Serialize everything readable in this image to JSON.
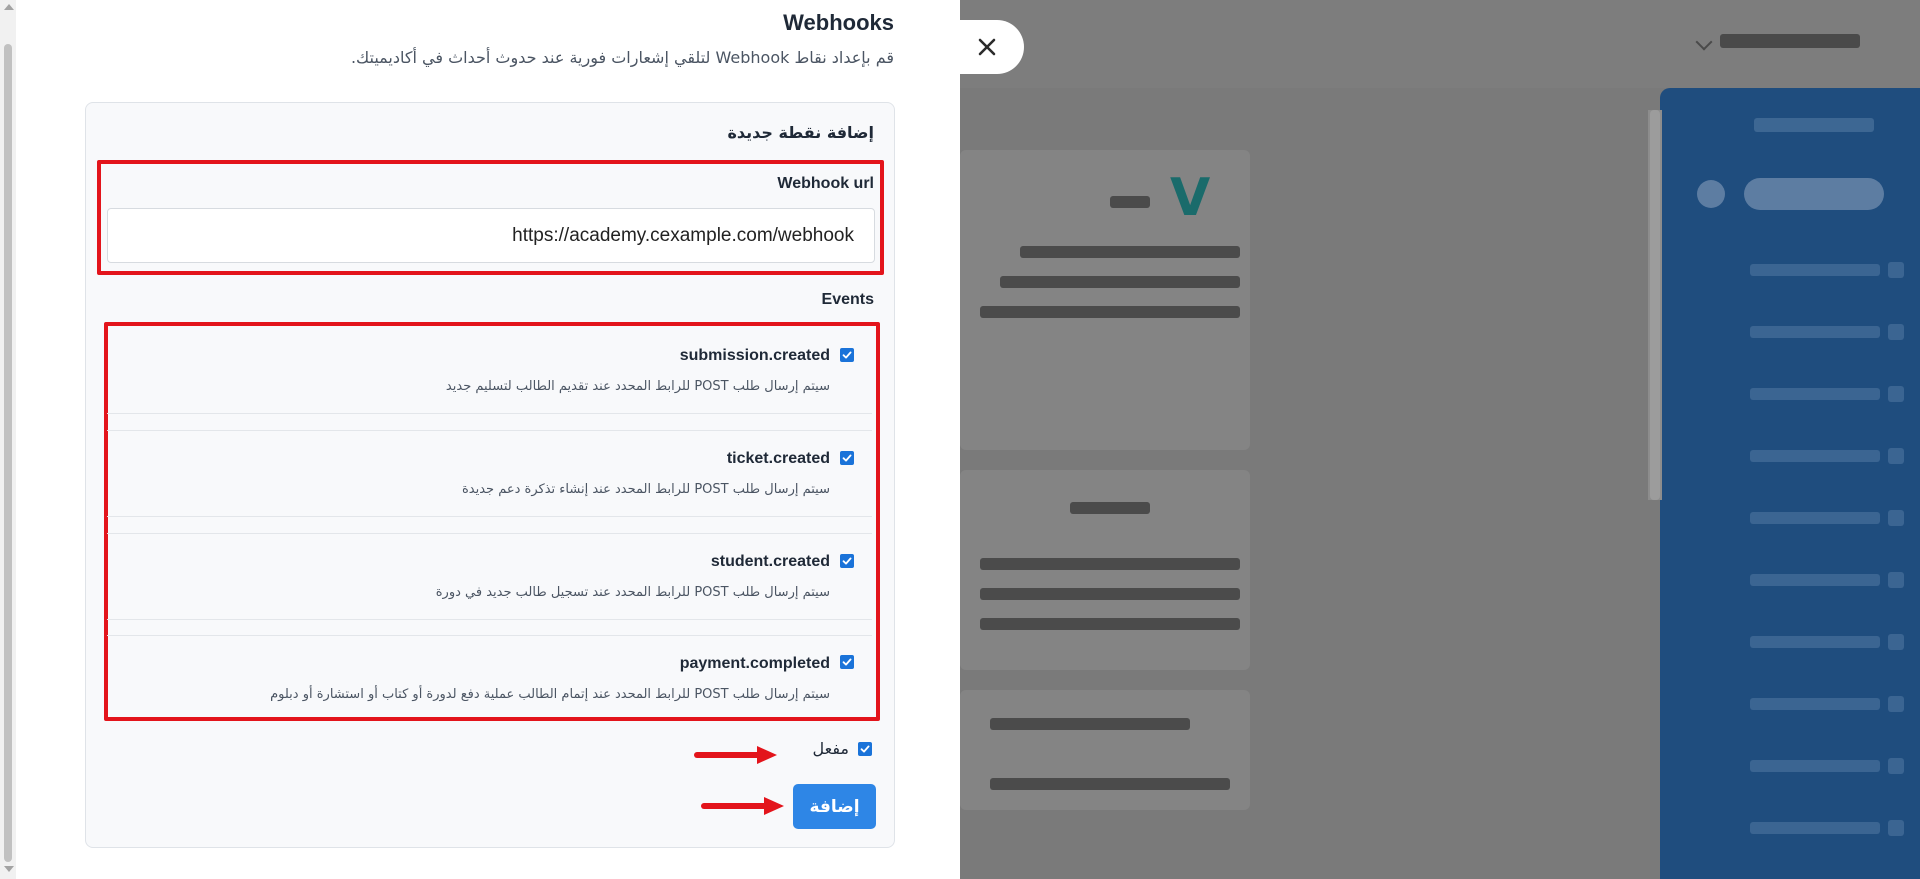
{
  "drawer": {
    "title": "Webhooks",
    "subtitle": "قم بإعداد نقاط Webhook لتلقي إشعارات فورية عند حدوث أحداث في أكاديميتك."
  },
  "form": {
    "heading": "إضافة نقطة جديدة",
    "url_label": "Webhook url",
    "url_value": "https://academy.cexample.com/webhook",
    "events_label": "Events",
    "events": [
      {
        "name": "submission.created",
        "description": "سيتم إرسال طلب POST للرابط المحدد عند تقديم الطالب لتسليم جديد",
        "checked": true
      },
      {
        "name": "ticket.created",
        "description": "سيتم إرسال طلب POST للرابط المحدد عند إنشاء تذكرة دعم جديدة",
        "checked": true
      },
      {
        "name": "student.created",
        "description": "سيتم إرسال طلب POST للرابط المحدد عند تسجيل طالب جديد في دورة",
        "checked": true
      },
      {
        "name": "payment.completed",
        "description": "سيتم إرسال طلب POST للرابط المحدد عند إتمام الطالب عملية دفع لدورة أو كتاب أو استشارة أو دبلوم",
        "checked": true
      }
    ],
    "enabled_label": "مفعل",
    "enabled_checked": true,
    "submit_label": "إضافة"
  },
  "colors": {
    "highlight": "#e3141b",
    "primary_button": "#2e86e6",
    "checkbox": "#1a73d9",
    "overlay": "#7a7a7a"
  },
  "icons": {
    "close": "close-icon",
    "checkbox": "checkmark-icon",
    "annotation": "arrow-right-icon"
  }
}
